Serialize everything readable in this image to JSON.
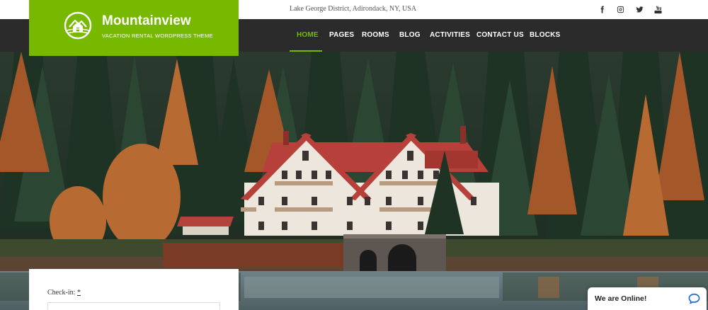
{
  "brand": {
    "name": "Mountainview",
    "tagline": "VACATION RENTAL WORDPRESS THEME",
    "accent": "#76b900"
  },
  "topbar": {
    "address": "Lake George District, Adirondack, NY, USA",
    "social": [
      "facebook-icon",
      "instagram-icon",
      "twitter-icon",
      "youtube-icon"
    ]
  },
  "nav": {
    "items": [
      {
        "label": "HOME",
        "active": true
      },
      {
        "label": "PAGES"
      },
      {
        "label": "ROOMS"
      },
      {
        "label": "BLOG"
      },
      {
        "label": "ACTIVITIES"
      },
      {
        "label": "CONTACT US"
      },
      {
        "label": "BLOCKS"
      }
    ]
  },
  "booking": {
    "checkin_label": "Check-in:",
    "required_mark": "*"
  },
  "chat": {
    "label": "We are Online!",
    "color": "#1f6fd1"
  }
}
